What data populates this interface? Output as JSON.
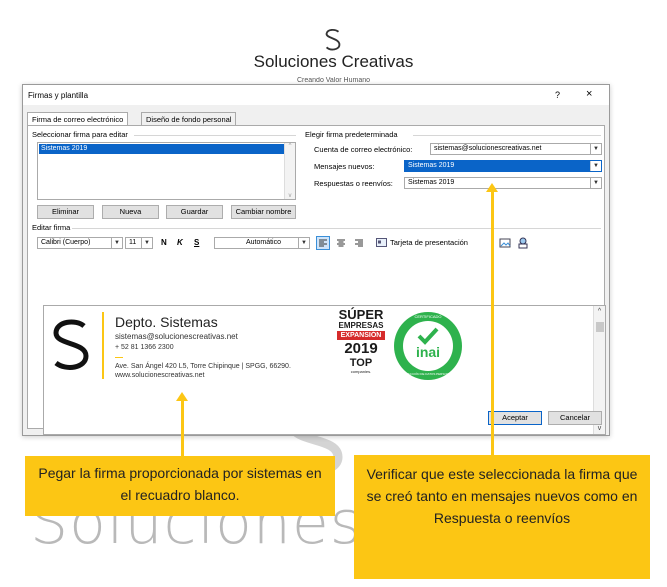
{
  "brand": {
    "name": "Soluciones Creativas",
    "tagline": "Creando Valor Humano",
    "watermark": "Soluciones C"
  },
  "dialog": {
    "title": "Firmas y plantilla",
    "help": "?",
    "close": "×",
    "tabs": [
      {
        "label": "Firma de correo electrónico",
        "active": true
      },
      {
        "label": "Diseño de fondo personal",
        "active": false
      }
    ],
    "select_label": "Seleccionar firma para editar",
    "signatures": [
      "Sistemas 2019"
    ],
    "buttons": {
      "delete": "Eliminar",
      "new": "Nueva",
      "save": "Guardar",
      "rename": "Cambiar nombre"
    },
    "default": {
      "group_label": "Elegir firma predeterminada",
      "account_label": "Cuenta de correo electrónico:",
      "account_value": "sistemas@solucionescreativas.net",
      "new_messages_label": "Mensajes nuevos:",
      "new_messages_value": "Sistemas 2019",
      "replies_label": "Respuestas o reenvíos:",
      "replies_value": "Sistemas 2019"
    },
    "edit": {
      "label": "Editar firma",
      "font": "Calibri (Cuerpo)",
      "size": "11",
      "bold": "N",
      "italic": "K",
      "underline": "S",
      "color": "Automático",
      "business_card": "Tarjeta de presentación"
    },
    "signature_content": {
      "name": "Depto. Sistemas",
      "email": "sistemas@solucionescreativas.net",
      "phone": "+ 52 81 1366 2300",
      "address": "Ave. San Ángel 420 L5, Torre Chipinque  | SPGG, 66290.",
      "website": "www.solucionescreativas.net",
      "badge_super_1": "SÚPER",
      "badge_super_2": "EMPRESAS",
      "badge_expansion": "EXPANSIÓN",
      "badge_year": "2019",
      "badge_top": "TOP",
      "badge_companies": "companies.",
      "inai_cert": "CERTIFICADO",
      "inai_name": "inai",
      "inai_ring": "PROTECCIÓN DE DATOS PERSONALES"
    },
    "accept": "Aceptar",
    "cancel": "Cancelar"
  },
  "callouts": {
    "left": "Pegar la firma proporcionada por sistemas en el recuadro blanco.",
    "right": "Verificar que este seleccionada la firma que se creó tanto en mensajes nuevos como en Respuesta o reenvíos"
  },
  "colors": {
    "accent_yellow": "#fcc614",
    "selection_blue": "#0a64c8",
    "inai_green": "#2eb24d",
    "expansion_red": "#d62b2b",
    "watermark_gray": "#b9b9b9"
  }
}
